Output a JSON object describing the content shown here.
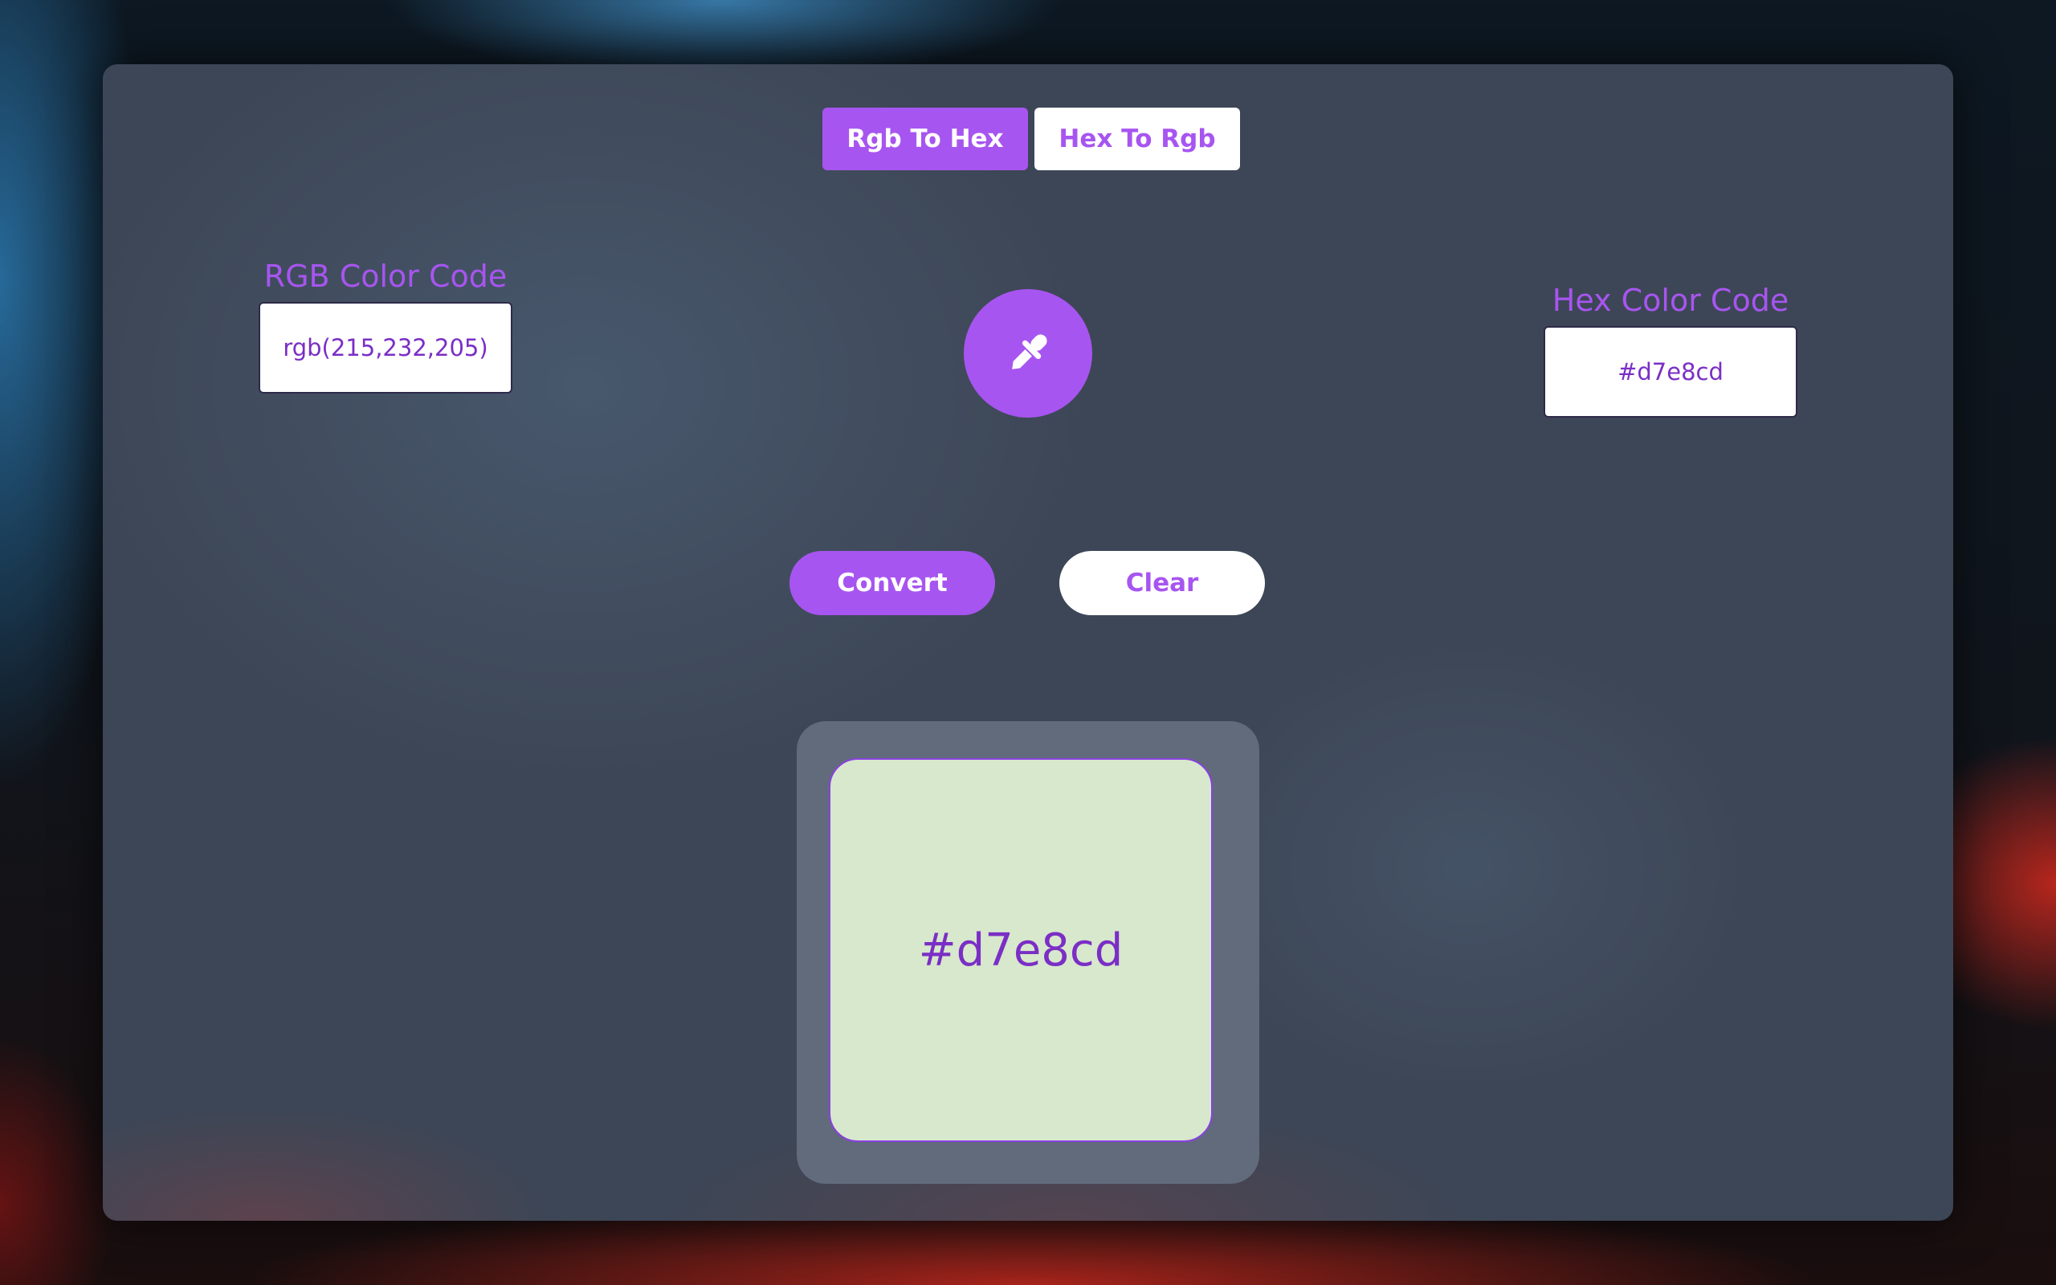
{
  "tabs": {
    "rgb_to_hex": "Rgb To Hex",
    "hex_to_rgb": "Hex To Rgb",
    "active": "rgb_to_hex"
  },
  "rgb_field": {
    "label": "RGB Color Code",
    "value": "rgb(215,232,205)"
  },
  "hex_field": {
    "label": "Hex Color Code",
    "value": "#d7e8cd"
  },
  "picker": {
    "icon": "eyedropper-icon"
  },
  "actions": {
    "convert_label": "Convert",
    "clear_label": "Clear"
  },
  "preview": {
    "color": "#d7e8cd",
    "label": "#d7e8cd"
  },
  "colors": {
    "accent": "#a755f0",
    "text_accent": "#7b2ec5",
    "panel": "#3d4656"
  }
}
